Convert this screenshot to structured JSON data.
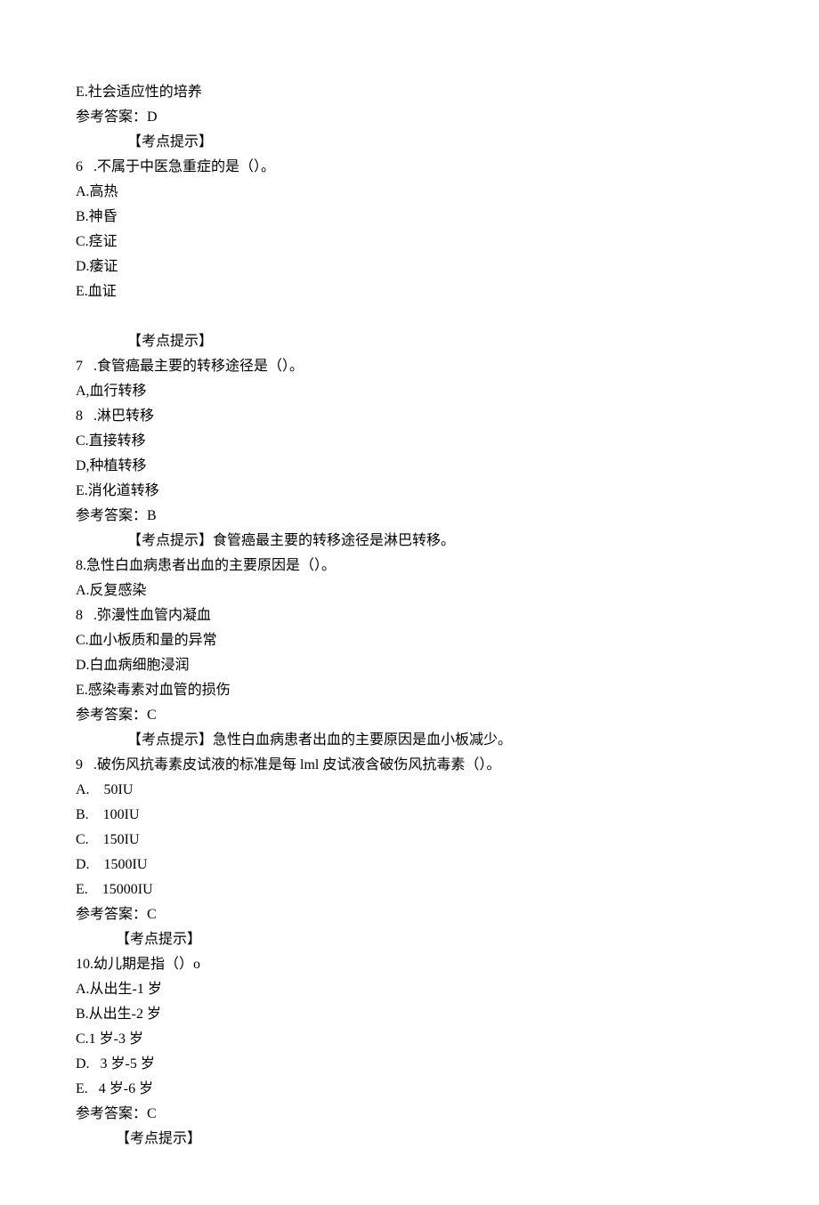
{
  "lines": {
    "l1": "E.社会适应性的培养",
    "l2": "参考答案：D",
    "l3": "【考点提示】",
    "l4": "6   .不属于中医急重症的是（）。",
    "l5": "A.高热",
    "l6": "B.神昏",
    "l7": "C.痉证",
    "l8": "D.痿证",
    "l9": "E.血证",
    "l10": "【考点提示】",
    "l11": "7   .食管癌最主要的转移途径是（）。",
    "l12": "A,血行转移",
    "l13": "8   .淋巴转移",
    "l14": "C.直接转移",
    "l15": "D,种植转移",
    "l16": "E.消化道转移",
    "l17": "参考答案：B",
    "l18": "【考点提示】食管癌最主要的转移途径是淋巴转移。",
    "l19": "8.急性白血病患者出血的主要原因是（）。",
    "l20": "A.反复感染",
    "l21": "8   .弥漫性血管内凝血",
    "l22": "C.血小板质和量的异常",
    "l23": "D.白血病细胞浸润",
    "l24": "E.感染毒素对血管的损伤",
    "l25": "参考答案：C",
    "l26": "【考点提示】急性白血病患者出血的主要原因是血小板减少。",
    "l27": "9   .破伤风抗毒素皮试液的标准是每 lml 皮试液含破伤风抗毒素（）。",
    "l28": "A.    50IU",
    "l29": "B.    100IU",
    "l30": "C.    150IU",
    "l31": "D.    1500IU",
    "l32": "E.    15000IU",
    "l33": "参考答案：C",
    "l34": "【考点提示】",
    "l35": "10.幼儿期是指（）o",
    "l36": "A.从出生-1 岁",
    "l37": "B.从出生-2 岁",
    "l38": "C.1 岁-3 岁",
    "l39": "D.   3 岁-5 岁",
    "l40": "E.   4 岁-6 岁",
    "l41": "参考答案：C",
    "l42": "【考点提示】"
  }
}
